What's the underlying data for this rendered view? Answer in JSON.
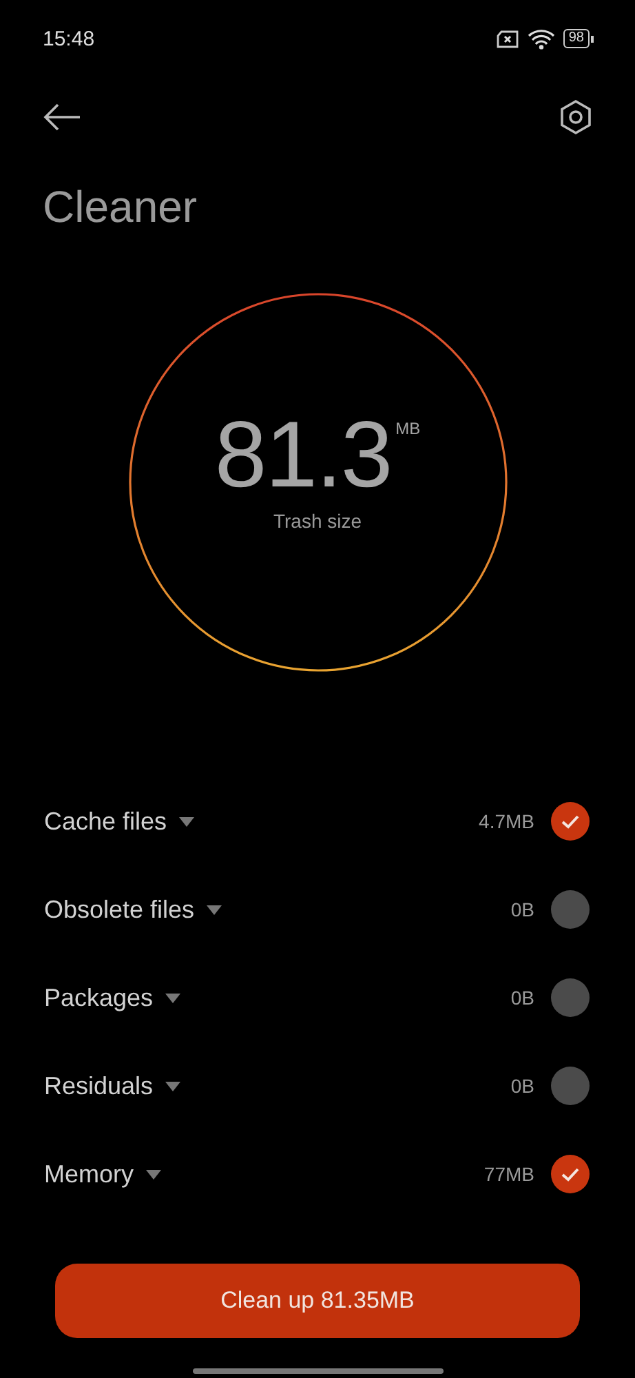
{
  "status_bar": {
    "time": "15:48",
    "battery": "98"
  },
  "title": "Cleaner",
  "gauge": {
    "value": "81.3",
    "unit": "MB",
    "caption": "Trash size"
  },
  "items": [
    {
      "label": "Cache files",
      "size": "4.7MB",
      "checked": true
    },
    {
      "label": "Obsolete files",
      "size": "0B",
      "checked": false
    },
    {
      "label": "Packages",
      "size": "0B",
      "checked": false
    },
    {
      "label": "Residuals",
      "size": "0B",
      "checked": false
    },
    {
      "label": "Memory",
      "size": "77MB",
      "checked": true
    }
  ],
  "button": "Clean up 81.35MB"
}
